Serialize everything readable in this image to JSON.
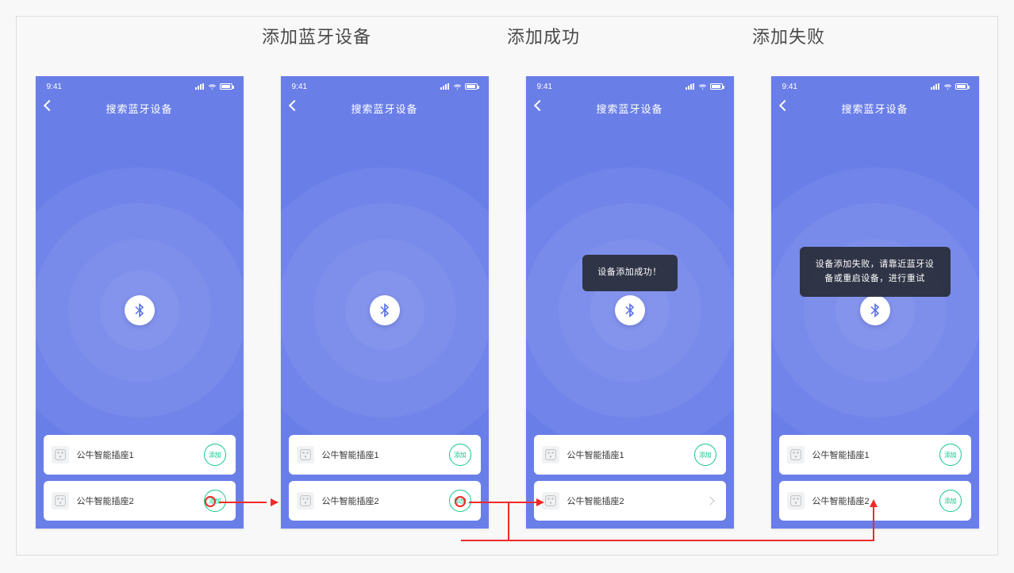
{
  "labels": {
    "col1": "",
    "col2": "添加蓝牙设备",
    "col3": "添加成功",
    "col4": "添加失败"
  },
  "common": {
    "time": "9:41",
    "nav_title": "搜索蓝牙设备",
    "add_label": "添加"
  },
  "device_names": {
    "d1": "公牛智能插座1",
    "d2": "公牛智能插座2"
  },
  "toasts": {
    "success": "设备添加成功！",
    "fail": "设备添加失败，请靠近蓝牙设备或重启设备，进行重试"
  }
}
